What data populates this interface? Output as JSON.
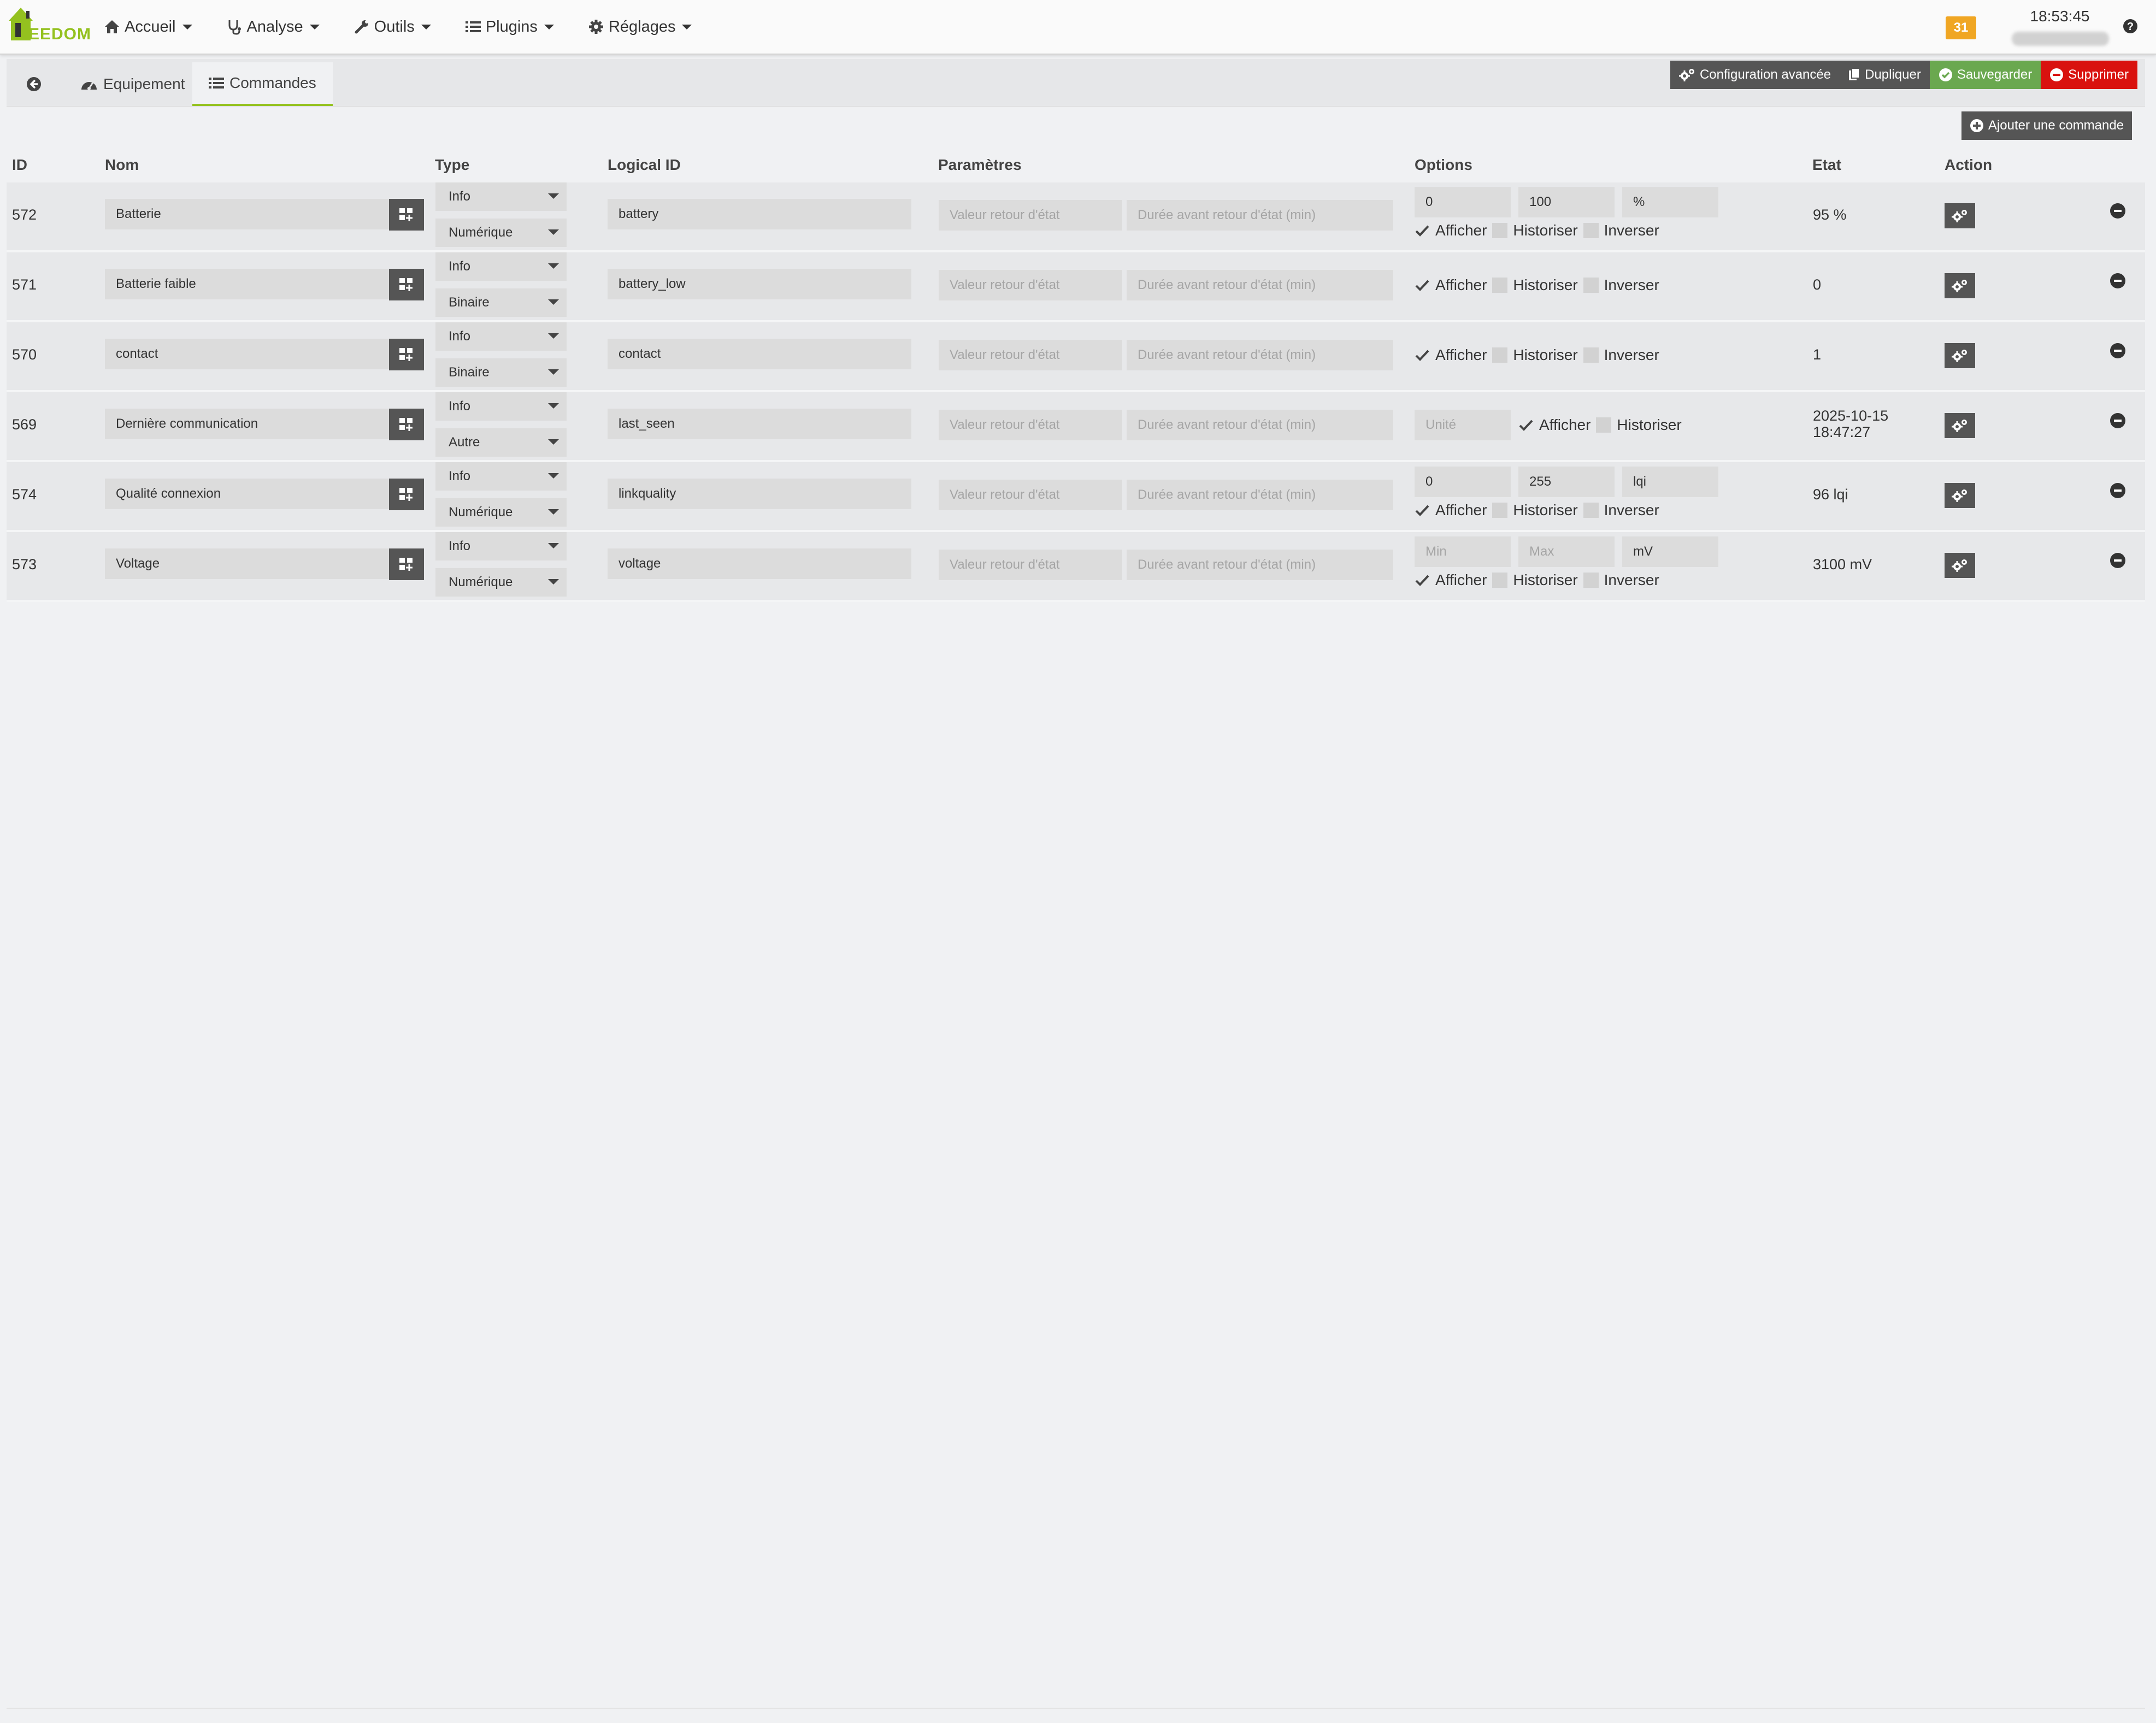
{
  "nav": {
    "logo_text": "EEDOM",
    "items": [
      {
        "label": "Accueil",
        "icon": "home-icon"
      },
      {
        "label": "Analyse",
        "icon": "stethoscope-icon"
      },
      {
        "label": "Outils",
        "icon": "wrench-icon"
      },
      {
        "label": "Plugins",
        "icon": "list-icon"
      },
      {
        "label": "Réglages",
        "icon": "gear-icon"
      }
    ],
    "message_count": "31",
    "time": "18:53:45"
  },
  "tabs": {
    "equipement": "Equipement",
    "commandes": "Commandes"
  },
  "actions": {
    "config": "Configuration avancée",
    "duplicate": "Dupliquer",
    "save": "Sauvegarder",
    "delete": "Supprimer",
    "add_command": "Ajouter une commande"
  },
  "colors": {
    "accent": "#94c11f",
    "save": "#6aa84f",
    "delete": "#d9120f",
    "badge": "#f0a623",
    "dark_button": "#555555"
  },
  "table": {
    "headers": {
      "id": "ID",
      "nom": "Nom",
      "type": "Type",
      "logical": "Logical ID",
      "params": "Paramètres",
      "options": "Options",
      "etat": "Etat",
      "action": "Action"
    },
    "placeholders": {
      "valeur_retour": "Valeur retour d'état",
      "duree_retour": "Durée avant retour d'état (min)"
    },
    "labels": {
      "afficher": "Afficher",
      "historiser": "Historiser",
      "inverser": "Inverser"
    },
    "rows": [
      {
        "id": "572",
        "nom": "Batterie",
        "type": "Info",
        "subtype": "Numérique",
        "logical": "battery",
        "min": "0",
        "max": "100",
        "unit": "%",
        "etat": "95 %"
      },
      {
        "id": "571",
        "nom": "Batterie faible",
        "type": "Info",
        "subtype": "Binaire",
        "logical": "battery_low",
        "etat": "0"
      },
      {
        "id": "570",
        "nom": "contact",
        "type": "Info",
        "subtype": "Binaire",
        "logical": "contact",
        "etat": "1"
      },
      {
        "id": "569",
        "nom": "Dernière communication",
        "type": "Info",
        "subtype": "Autre",
        "logical": "last_seen",
        "unit_placeholder": "Unité",
        "etat_date": "2025-10-15",
        "etat_time": "18:47:27"
      },
      {
        "id": "574",
        "nom": "Qualité connexion",
        "type": "Info",
        "subtype": "Numérique",
        "logical": "linkquality",
        "min": "0",
        "max": "255",
        "unit": "lqi",
        "etat": "96 lqi"
      },
      {
        "id": "573",
        "nom": "Voltage",
        "type": "Info",
        "subtype": "Numérique",
        "logical": "voltage",
        "min_placeholder": "Min",
        "max_placeholder": "Max",
        "unit": "mV",
        "etat": "3100 mV"
      }
    ]
  }
}
